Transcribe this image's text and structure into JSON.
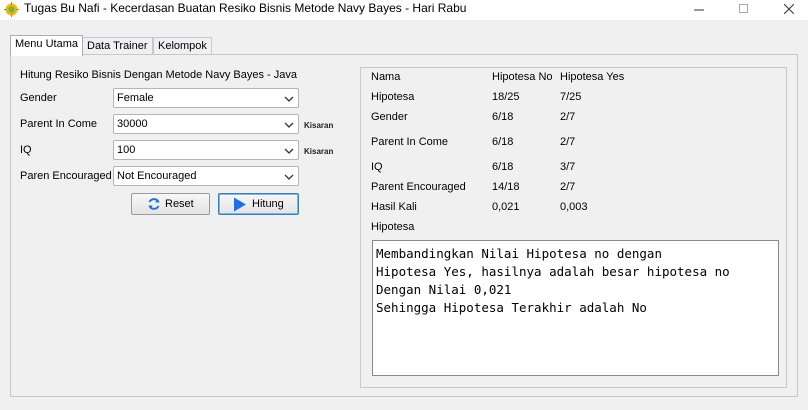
{
  "window": {
    "title": "Tugas Bu Nafi - Kecerdasan Buatan Resiko Bisnis Metode Navy Bayes - Hari Rabu"
  },
  "tabs": [
    "Menu Utama",
    "Data Trainer",
    "Kelompok"
  ],
  "form": {
    "heading": "Hitung Resiko Bisnis Dengan Metode Navy Bayes - Java",
    "gender_label": "Gender",
    "gender_value": "Female",
    "parent_income_label": "Parent In Come",
    "parent_income_value": "30000",
    "parent_income_hint": "Kisaran",
    "iq_label": "IQ",
    "iq_value": "100",
    "iq_hint": "Kisaran",
    "parent_encouraged_label": "Paren Encouraged",
    "parent_encouraged_value": "Not Encouraged",
    "reset_label": "Reset",
    "hitung_label": "Hitung"
  },
  "results": {
    "header": {
      "name": "Nama",
      "no": "Hipotesa No",
      "yes": "Hipotesa Yes"
    },
    "rows": [
      {
        "name": "Hipotesa",
        "no": "18/25",
        "yes": "7/25"
      },
      {
        "name": "Gender",
        "no": "6/18",
        "yes": "2/7"
      },
      {
        "name": "Parent In Come",
        "no": "6/18",
        "yes": "2/7"
      },
      {
        "name": "IQ",
        "no": "6/18",
        "yes": "3/7"
      },
      {
        "name": "Parent Encouraged",
        "no": "14/18",
        "yes": "2/7"
      },
      {
        "name": "Hasil Kali",
        "no": "0,021",
        "yes": "0,003"
      }
    ],
    "conclusion_label": "Hipotesa",
    "conclusion_lines": [
      "Membandingkan Nilai Hipotesa no dengan",
      "Hipotesa Yes, hasilnya adalah besar hipotesa no",
      "Dengan Nilai 0,021",
      "Sehingga Hipotesa Terakhir adalah No"
    ]
  },
  "icons": {
    "app": "java-coffee-icon",
    "reset": "refresh-icon",
    "hitung": "play-icon",
    "dropdown": "chevron-down-icon"
  },
  "colors": {
    "reset_icon": "#2a6fd6",
    "hitung_icon": "#1e6fe0",
    "focus_border": "#3c7fb1"
  }
}
